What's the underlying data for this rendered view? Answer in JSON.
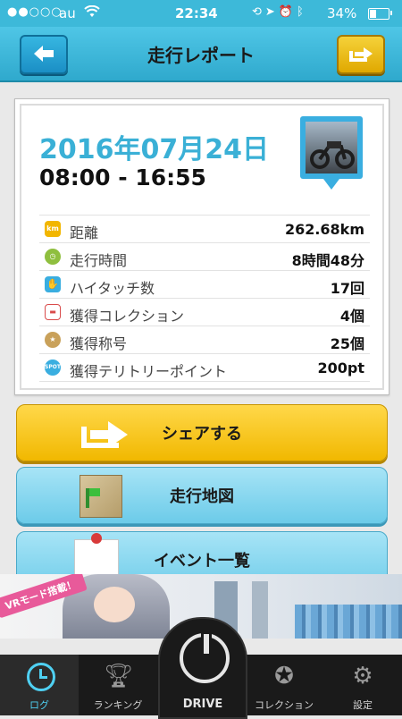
{
  "status": {
    "signal": "●●○○○",
    "carrier": "au",
    "wifi_icon": "wifi-icon",
    "time": "22:34",
    "icons": [
      "rotation-lock-icon",
      "location-icon",
      "alarm-icon",
      "bluetooth-icon"
    ],
    "battery": "34%",
    "battery_level": 0.34
  },
  "header": {
    "title": "走行レポート",
    "back_icon": "back-arrow-icon",
    "share_icon": "share-icon"
  },
  "report": {
    "date": "2016年07月24日",
    "time_range": "08:00 - 16:55",
    "stats": [
      {
        "icon": "km-icon",
        "icon_text": "km",
        "icon_color": "#f2b600",
        "label": "距離",
        "value": "262.68km"
      },
      {
        "icon": "clock-icon",
        "icon_text": "",
        "icon_color": "#8fbf3f",
        "label": "走行時間",
        "value": "8時間48分"
      },
      {
        "icon": "high-five-icon",
        "icon_text": "",
        "icon_color": "#3aaee0",
        "label": "ハイタッチ数",
        "value": "17回"
      },
      {
        "icon": "car-icon",
        "icon_text": "",
        "icon_color": "#d94b4b",
        "label": "獲得コレクション",
        "value": "4個"
      },
      {
        "icon": "medal-icon",
        "icon_text": "",
        "icon_color": "#c9a15a",
        "label": "獲得称号",
        "value": "25個"
      },
      {
        "icon": "spot-icon",
        "icon_text": "SPOT",
        "icon_color": "#3aaee0",
        "label": "獲得テリトリーポイント",
        "value": "200pt"
      }
    ]
  },
  "buttons": {
    "share": "シェアする",
    "map": "走行地図",
    "events": "イベント一覧"
  },
  "banner": {
    "tag": "VRモード搭載！"
  },
  "tabs": [
    {
      "label": "ログ",
      "icon": "clock-icon"
    },
    {
      "label": "ランキング",
      "icon": "trophy-icon"
    },
    {
      "label": "DRIVE",
      "icon": "power-icon"
    },
    {
      "label": "コレクション",
      "icon": "star-medal-icon"
    },
    {
      "label": "設定",
      "icon": "gear-icon"
    }
  ],
  "colors": {
    "accent": "#3db9d9",
    "share_yellow": "#f1b800",
    "date_blue": "#3ab0d6",
    "tab_active": "#4fd0f2"
  }
}
